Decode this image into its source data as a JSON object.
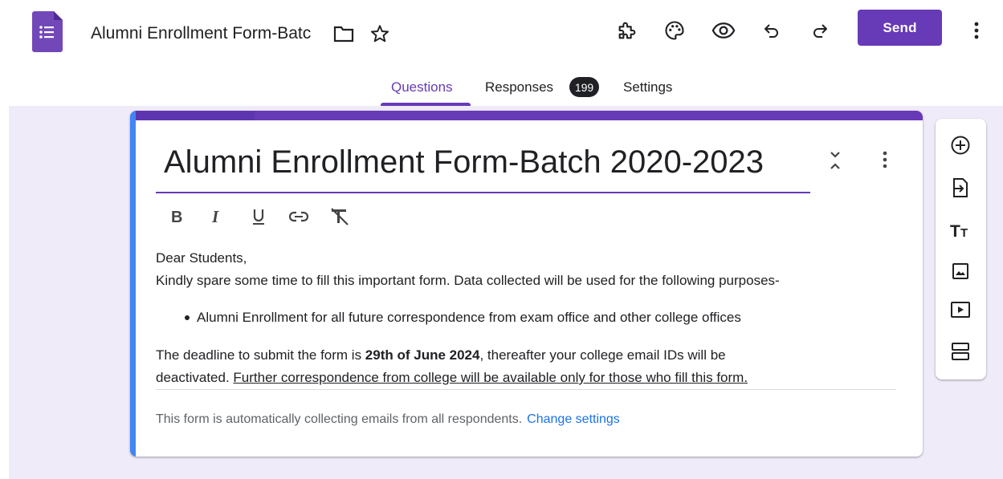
{
  "header": {
    "doc_title": "Alumni Enrollment Form-Batc",
    "send_label": "Send",
    "icons": [
      "forms-app-icon",
      "folder-icon",
      "star-icon",
      "addon-puzzle-icon",
      "palette-icon",
      "preview-eye-icon",
      "undo-icon",
      "redo-icon",
      "more-vert-icon"
    ]
  },
  "tabs": {
    "questions": "Questions",
    "responses": "Responses",
    "responses_count": "199",
    "settings": "Settings"
  },
  "form": {
    "title": "Alumni Enrollment Form-Batch 2020-2023",
    "desc_line1": "Dear Students,",
    "desc_line2": "Kindly spare some time to fill this important form. Data collected will be used for the following purposes-",
    "bullet1": "Alumni Enrollment for all future correspondence from exam office and other college offices",
    "deadline_prefix": "The deadline to submit the form is ",
    "deadline_date": "29th of June 2024",
    "deadline_suffix": ", thereafter your college email IDs will be",
    "deactivated_prefix": "deactivated. ",
    "further_note": "Further correspondence from college will be available only for those who fill this form.",
    "notice": "This form is automatically collecting emails from all respondents.",
    "change_settings": "Change settings"
  },
  "colors": {
    "accent": "#673ab7",
    "canvas_bg": "#f0ebf8",
    "link": "#1a73e8",
    "card_left_edge": "#4285f4"
  }
}
